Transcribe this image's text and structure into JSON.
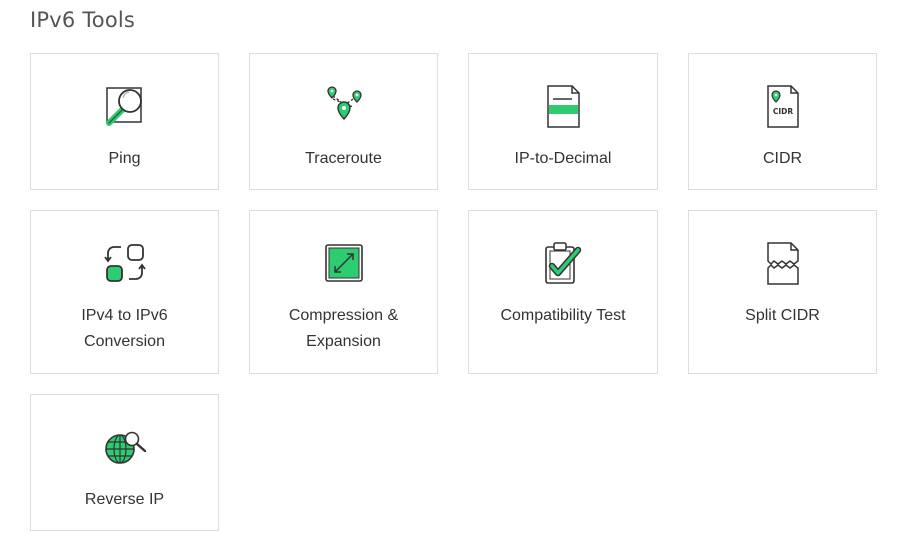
{
  "page": {
    "title": "IPv6 Tools"
  },
  "colors": {
    "accent": "#2ecc71",
    "icon_stroke": "#333333",
    "card_border": "#dddddd",
    "title_text": "#555555",
    "label_text": "#333333"
  },
  "tools": [
    {
      "label": "Ping",
      "icon": "ping-icon"
    },
    {
      "label": "Traceroute",
      "icon": "traceroute-icon"
    },
    {
      "label": "IP-to-Decimal",
      "icon": "ip-to-decimal-icon"
    },
    {
      "label": "CIDR",
      "icon": "cidr-icon",
      "icon_text": "CIDR"
    },
    {
      "label": "IPv4 to IPv6\nConversion",
      "icon": "conversion-icon"
    },
    {
      "label": "Compression &\nExpansion",
      "icon": "compression-expansion-icon"
    },
    {
      "label": "Compatibility Test",
      "icon": "compatibility-test-icon"
    },
    {
      "label": "Split CIDR",
      "icon": "split-cidr-icon"
    },
    {
      "label": "Reverse IP",
      "icon": "reverse-ip-icon"
    }
  ]
}
